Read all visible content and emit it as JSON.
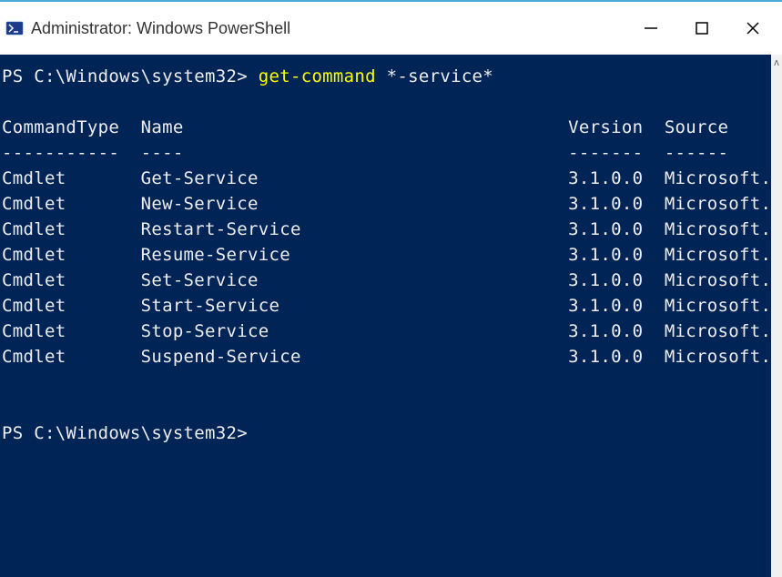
{
  "window": {
    "title": "Administrator: Windows PowerShell"
  },
  "prompt": {
    "path1": "PS C:\\Windows\\system32>",
    "command": "get-command",
    "argument": "*-service*",
    "path2": "PS C:\\Windows\\system32>"
  },
  "headers": {
    "col1": "CommandType",
    "col2": "Name",
    "col3": "Version",
    "col4": "Source"
  },
  "dividers": {
    "col1": "-----------",
    "col2": "----",
    "col3": "-------",
    "col4": "------"
  },
  "rows": [
    {
      "type": "Cmdlet",
      "name": "Get-Service",
      "version": "3.1.0.0",
      "source": "Microsoft.PowerShell.Management"
    },
    {
      "type": "Cmdlet",
      "name": "New-Service",
      "version": "3.1.0.0",
      "source": "Microsoft.PowerShell.Management"
    },
    {
      "type": "Cmdlet",
      "name": "Restart-Service",
      "version": "3.1.0.0",
      "source": "Microsoft.PowerShell.Management"
    },
    {
      "type": "Cmdlet",
      "name": "Resume-Service",
      "version": "3.1.0.0",
      "source": "Microsoft.PowerShell.Management"
    },
    {
      "type": "Cmdlet",
      "name": "Set-Service",
      "version": "3.1.0.0",
      "source": "Microsoft.PowerShell.Management"
    },
    {
      "type": "Cmdlet",
      "name": "Start-Service",
      "version": "3.1.0.0",
      "source": "Microsoft.PowerShell.Management"
    },
    {
      "type": "Cmdlet",
      "name": "Stop-Service",
      "version": "3.1.0.0",
      "source": "Microsoft.PowerShell.Management"
    },
    {
      "type": "Cmdlet",
      "name": "Suspend-Service",
      "version": "3.1.0.0",
      "source": "Microsoft.PowerShell.Management"
    }
  ],
  "scrollbar": {
    "up_glyph": "ʌ"
  }
}
